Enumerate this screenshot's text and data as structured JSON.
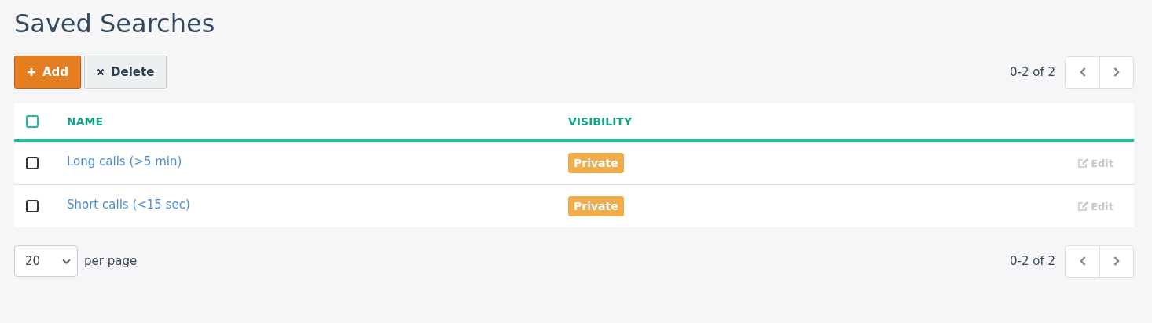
{
  "title": "Saved Searches",
  "toolbar": {
    "buttons": [
      {
        "kind": "add",
        "label": "Add"
      },
      {
        "kind": "delete",
        "label": "Delete"
      }
    ],
    "range": "0-2 of 2"
  },
  "table": {
    "select_all": {
      "checked": false
    },
    "columns": [
      "NAME",
      "VISIBILITY"
    ],
    "rows": [
      {
        "checked": false,
        "name": "Long calls (>5 min)",
        "visibility": "Private",
        "action": "Edit"
      },
      {
        "checked": false,
        "name": "Short calls (<15 sec)",
        "visibility": "Private",
        "action": "Edit"
      }
    ]
  },
  "footer": {
    "per_page": "20",
    "per_page_label": "per page",
    "range": "0-2 of 2"
  }
}
